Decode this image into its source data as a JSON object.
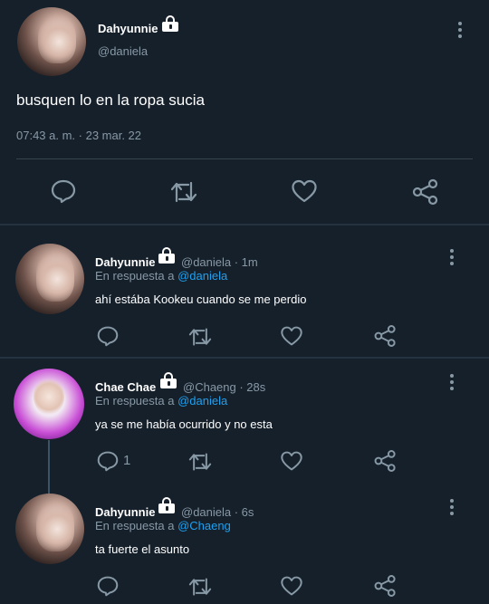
{
  "main_tweet": {
    "name": "Dahyunnie",
    "handle": "@daniela",
    "text": "busquen lo en la ropa sucia",
    "timestamp": "07:43 a. m. · 23 mar. 22"
  },
  "replies": [
    {
      "name": "Dahyunnie",
      "handle": "@daniela · 1m",
      "reply_prefix": "En respuesta a",
      "reply_to": "@daniela",
      "text": "ahí estába Kookeu cuando se me perdio",
      "reply_count": ""
    },
    {
      "name": "Chae Chae",
      "handle": "@Chaeng · 28s",
      "reply_prefix": "En respuesta a",
      "reply_to": "@daniela",
      "text": "ya se me había ocurrido y no esta",
      "reply_count": "1"
    },
    {
      "name": "Dahyunnie",
      "handle": "@daniela · 6s",
      "reply_prefix": "En respuesta a",
      "reply_to": "@Chaeng",
      "text": "ta fuerte el asunto",
      "reply_count": ""
    }
  ],
  "colors": {
    "background": "#15202b",
    "secondary_text": "#8899a6",
    "link": "#1da1f2",
    "divider": "#38444d"
  },
  "icons": [
    "lock-icon",
    "more-icon",
    "reply-icon",
    "retweet-icon",
    "like-icon",
    "share-icon"
  ]
}
